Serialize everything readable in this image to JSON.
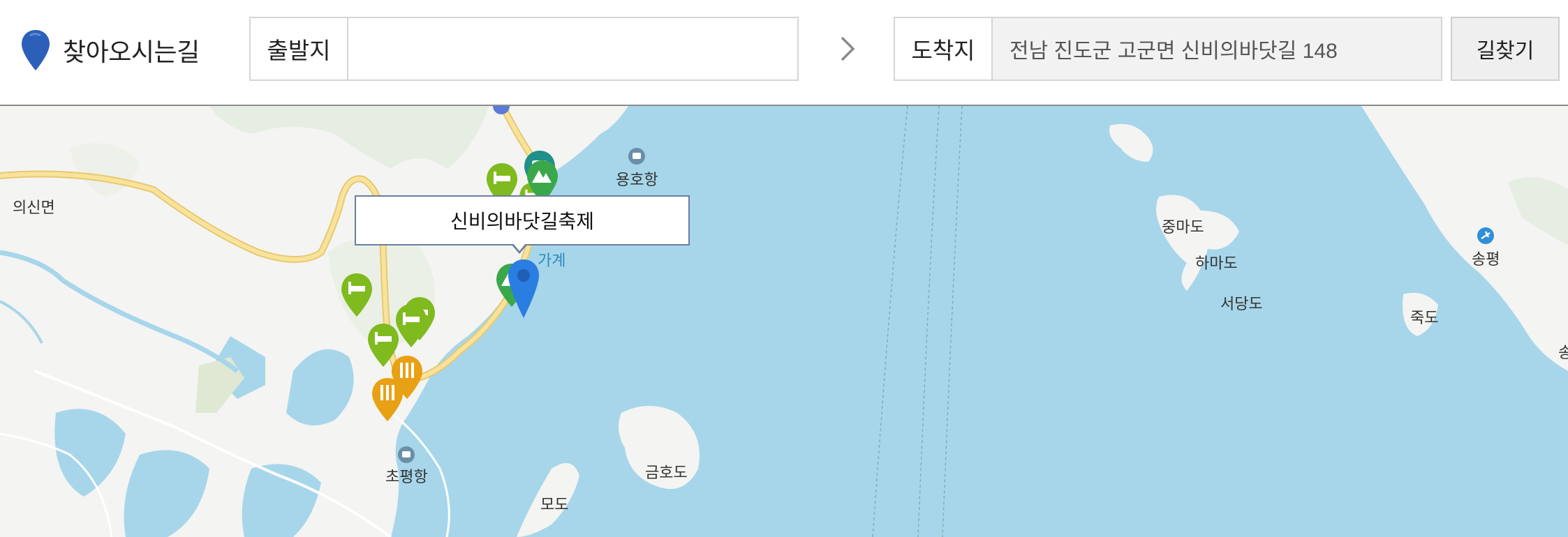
{
  "header": {
    "title": "찾아오시는길",
    "origin_label": "출발지",
    "origin_value": "",
    "origin_placeholder": "",
    "destination_label": "도착지",
    "destination_value": "전남 진도군 고군면 신비의바닷길 148",
    "search_button": "길찾기",
    "icons": {
      "brand": "location-pin-icon",
      "arrow": "chevron-right-icon"
    },
    "brand_color": "#2b5fb8"
  },
  "map": {
    "callout": "신비의바닷길축제",
    "labels": {
      "uisin": "의신면",
      "yongho": "용호항",
      "gagye": "가계",
      "jungmado": "중마도",
      "hamado": "하마도",
      "seodangdo": "서당도",
      "jukdo": "죽도",
      "songpyeong": "송평",
      "chopyeong": "초평항",
      "geumhodo": "금호도",
      "modo": "모도",
      "song_partial": "송"
    },
    "colors": {
      "sea": "#a7d6ea",
      "land": "#f4f4f2",
      "road": "#f5d983",
      "lodging": "#7fba1e",
      "camping": "#3aa84a",
      "restaurant": "#e8a115",
      "destination": "#2a7de1",
      "other": "#1f8f8a"
    },
    "marker_types": [
      "lodging-marker",
      "camping-marker",
      "restaurant-marker",
      "destination-marker"
    ]
  }
}
